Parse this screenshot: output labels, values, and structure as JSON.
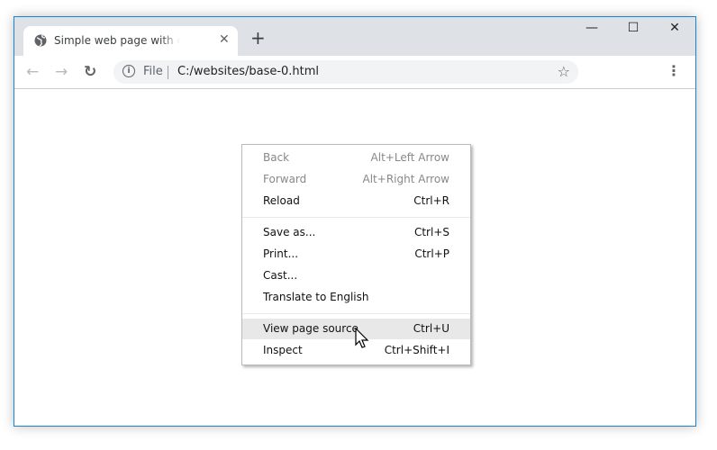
{
  "tab": {
    "title": "Simple web page with default styles",
    "icon": "globe-icon"
  },
  "new_tab": "+",
  "window_controls": {
    "minimize": "—",
    "maximize": "☐",
    "close": "✕"
  },
  "omnibox": {
    "scheme": "File",
    "url": "C:/websites/base-0.html"
  },
  "context_menu": {
    "groups": [
      [
        {
          "label": "Back",
          "shortcut": "Alt+Left Arrow",
          "disabled": true
        },
        {
          "label": "Forward",
          "shortcut": "Alt+Right Arrow",
          "disabled": true
        },
        {
          "label": "Reload",
          "shortcut": "Ctrl+R"
        }
      ],
      [
        {
          "label": "Save as...",
          "shortcut": "Ctrl+S"
        },
        {
          "label": "Print...",
          "shortcut": "Ctrl+P"
        },
        {
          "label": "Cast...",
          "shortcut": ""
        },
        {
          "label": "Translate to English",
          "shortcut": ""
        }
      ],
      [
        {
          "label": "View page source",
          "shortcut": "Ctrl+U",
          "highlighted": true
        },
        {
          "label": "Inspect",
          "shortcut": "Ctrl+Shift+I"
        }
      ]
    ]
  },
  "colors": {
    "accent_border": "#1883d7",
    "tabstrip": "#dee1e6",
    "highlight": "#e8e8e9"
  }
}
